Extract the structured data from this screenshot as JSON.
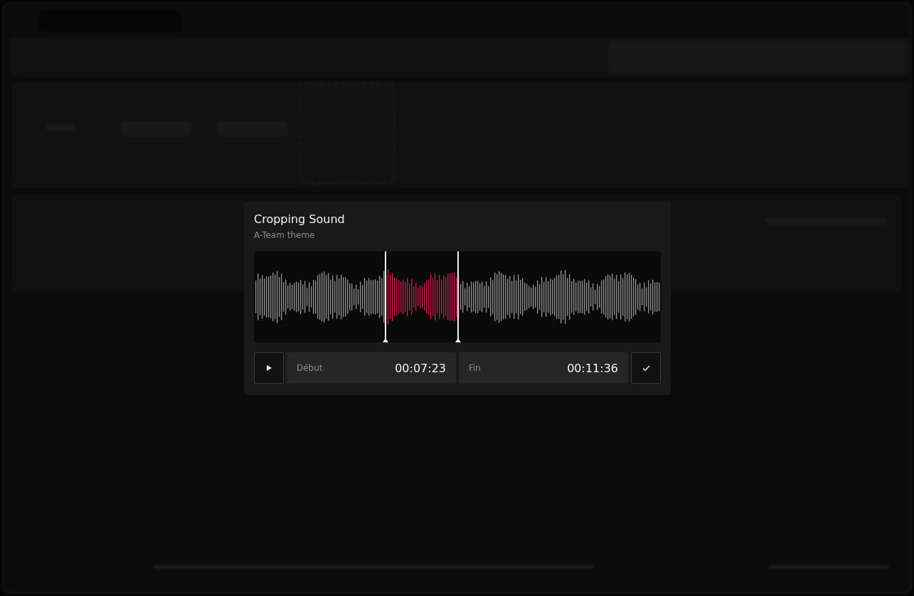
{
  "dialog": {
    "title": "Cropping Sound",
    "subtitle": "A-Team theme",
    "selection": [
      {
        "kind": "start",
        "level": 0.323
      },
      {
        "kind": "end",
        "level": 0.502
      }
    ],
    "fields": [
      {
        "label": "Début",
        "value": "00:07:23"
      },
      {
        "label": "Fin",
        "value": "00:11:36"
      }
    ]
  }
}
